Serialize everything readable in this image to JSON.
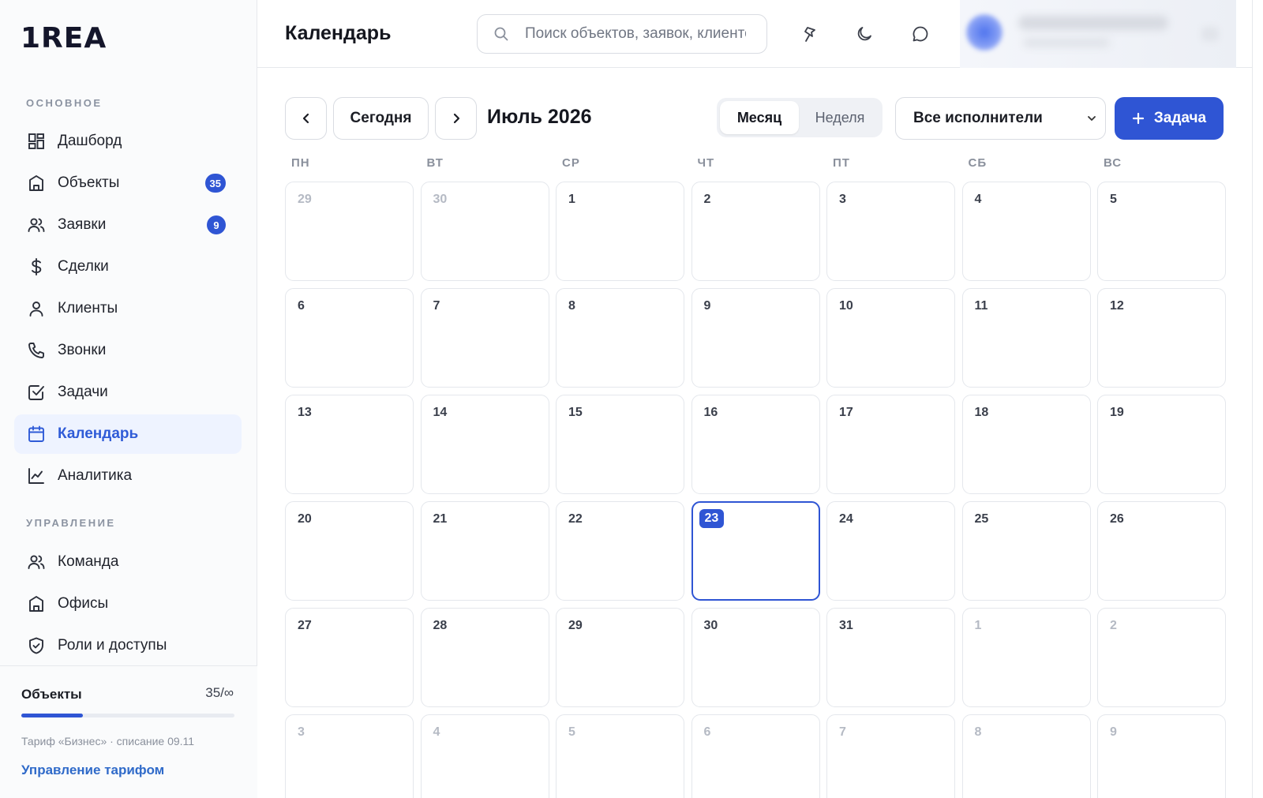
{
  "app": {
    "logo_text": "1REA"
  },
  "sidebar": {
    "section_main": "ОСНОВНОЕ",
    "section_admin": "УПРАВЛЕНИЕ",
    "main_items": [
      {
        "label": "Дашборд",
        "icon": "dashboard-icon",
        "badge": null,
        "active": false
      },
      {
        "label": "Объекты",
        "icon": "building-icon",
        "badge": "35",
        "active": false
      },
      {
        "label": "Заявки",
        "icon": "users-icon",
        "badge": "9",
        "active": false
      },
      {
        "label": "Сделки",
        "icon": "dollar-icon",
        "badge": null,
        "active": false
      },
      {
        "label": "Клиенты",
        "icon": "user-icon",
        "badge": null,
        "active": false
      },
      {
        "label": "Звонки",
        "icon": "phone-icon",
        "badge": null,
        "active": false
      },
      {
        "label": "Задачи",
        "icon": "checkbox-icon",
        "badge": null,
        "active": false
      },
      {
        "label": "Календарь",
        "icon": "calendar-icon",
        "badge": null,
        "active": true
      },
      {
        "label": "Аналитика",
        "icon": "chart-icon",
        "badge": null,
        "active": false
      }
    ],
    "admin_items": [
      {
        "label": "Команда",
        "icon": "users-icon",
        "badge": null,
        "active": false
      },
      {
        "label": "Офисы",
        "icon": "building-icon",
        "badge": null,
        "active": false
      },
      {
        "label": "Роли и доступы",
        "icon": "shield-icon",
        "badge": null,
        "active": false
      }
    ],
    "footer": {
      "title": "Объекты",
      "count": "35/∞",
      "progress_fraction": 0.29,
      "note": "Тариф «Бизнес» · списание 09.11",
      "link": "Управление тарифом"
    }
  },
  "header": {
    "title": "Календарь",
    "search_placeholder": "Поиск объектов, заявок, клиентов",
    "icons": [
      "pin-icon",
      "moon-icon",
      "chat-icon"
    ]
  },
  "calendar": {
    "today_button": "Сегодня",
    "month_label": "Июль 2026",
    "view_options": [
      "Месяц",
      "Неделя"
    ],
    "view_selected": "Месяц",
    "assignee_filter": "Все исполнители",
    "add_task_button": "Задача",
    "weekdays": [
      "ПН",
      "ВТ",
      "СР",
      "ЧТ",
      "ПТ",
      "СБ",
      "ВС"
    ],
    "today": "23",
    "weeks": [
      [
        {
          "d": "29",
          "o": true
        },
        {
          "d": "30",
          "o": true
        },
        {
          "d": "1",
          "o": false
        },
        {
          "d": "2",
          "o": false
        },
        {
          "d": "3",
          "o": false
        },
        {
          "d": "4",
          "o": false
        },
        {
          "d": "5",
          "o": false
        }
      ],
      [
        {
          "d": "6",
          "o": false
        },
        {
          "d": "7",
          "o": false
        },
        {
          "d": "8",
          "o": false
        },
        {
          "d": "9",
          "o": false
        },
        {
          "d": "10",
          "o": false
        },
        {
          "d": "11",
          "o": false
        },
        {
          "d": "12",
          "o": false
        }
      ],
      [
        {
          "d": "13",
          "o": false
        },
        {
          "d": "14",
          "o": false
        },
        {
          "d": "15",
          "o": false
        },
        {
          "d": "16",
          "o": false
        },
        {
          "d": "17",
          "o": false
        },
        {
          "d": "18",
          "o": false
        },
        {
          "d": "19",
          "o": false
        }
      ],
      [
        {
          "d": "20",
          "o": false
        },
        {
          "d": "21",
          "o": false
        },
        {
          "d": "22",
          "o": false
        },
        {
          "d": "23",
          "o": false
        },
        {
          "d": "24",
          "o": false
        },
        {
          "d": "25",
          "o": false
        },
        {
          "d": "26",
          "o": false
        }
      ],
      [
        {
          "d": "27",
          "o": false
        },
        {
          "d": "28",
          "o": false
        },
        {
          "d": "29",
          "o": false
        },
        {
          "d": "30",
          "o": false
        },
        {
          "d": "31",
          "o": false
        },
        {
          "d": "1",
          "o": true
        },
        {
          "d": "2",
          "o": true
        }
      ],
      [
        {
          "d": "3",
          "o": true
        },
        {
          "d": "4",
          "o": true
        },
        {
          "d": "5",
          "o": true
        },
        {
          "d": "6",
          "o": true
        },
        {
          "d": "7",
          "o": true
        },
        {
          "d": "8",
          "o": true
        },
        {
          "d": "9",
          "o": true
        }
      ]
    ]
  },
  "colors": {
    "accent": "#2f55d4",
    "link": "#2f6ac9",
    "active_bg": "#eef3ff"
  }
}
